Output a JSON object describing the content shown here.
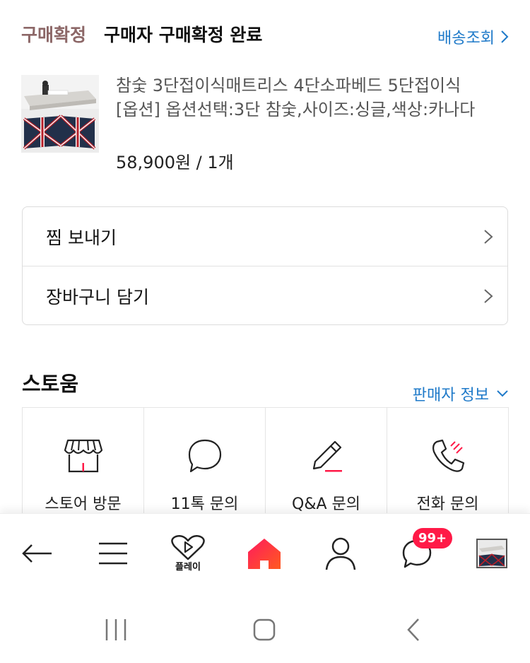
{
  "header": {
    "status_label": "구매확정",
    "status_title": "구매자 구매확정 완료",
    "tracking_label": "배송조회"
  },
  "product": {
    "name": "참숯 3단접이식매트리스 4단소파베드 5단접이식",
    "option": "[옵션] 옵션선택:3단 참숯,사이즈:싱글,색상:카나다",
    "price": "58,900원 / 1개"
  },
  "actions": {
    "wishlist_label": "찜 보내기",
    "cart_label": "장바구니 담기"
  },
  "store": {
    "name": "스토움",
    "seller_info_label": "판매자 정보",
    "contacts": [
      {
        "label": "스토어 방문",
        "icon": "store-icon"
      },
      {
        "label": "11톡 문의",
        "icon": "chat-bubble-icon"
      },
      {
        "label": "Q&A 문의",
        "icon": "pencil-icon"
      },
      {
        "label": "전화 문의",
        "icon": "phone-icon"
      }
    ]
  },
  "bottom_nav": {
    "play_label": "플레이",
    "badge_count": "99+",
    "items": [
      "back-arrow-icon",
      "menu-icon",
      "play-heart-icon",
      "home-icon",
      "user-icon",
      "talk-icon",
      "recent-product-thumbnail"
    ]
  },
  "colors": {
    "accent_blue": "#1f7ac9",
    "status_brown": "#8c6767",
    "brand_red": "#ff1a47",
    "home_gradient_start": "#ff1a5e",
    "home_gradient_end": "#ff5a1f"
  }
}
